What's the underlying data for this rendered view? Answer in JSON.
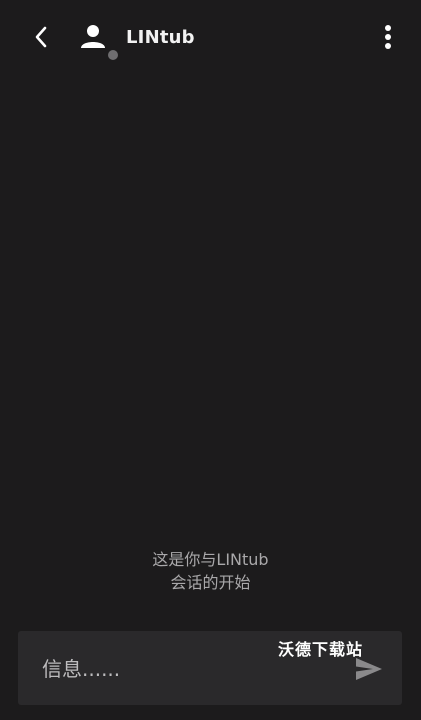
{
  "header": {
    "back_icon": "chevron-left-icon",
    "avatar_icon": "person-icon",
    "contact_name": "LINtub",
    "presence_status_color": "#6f6e70",
    "menu_icon": "more-vertical-icon"
  },
  "conversation": {
    "start_line1": "这是你与LINtub",
    "start_line2": "会话的开始"
  },
  "composer": {
    "placeholder": "信息......",
    "value": "",
    "send_icon": "send-icon"
  },
  "watermark": {
    "text": "沃德下载站"
  },
  "colors": {
    "background": "#1c1b1c",
    "composer_background": "#2a292b",
    "secondary_text": "#a9a8aa",
    "send_icon_color": "#8a898b"
  }
}
